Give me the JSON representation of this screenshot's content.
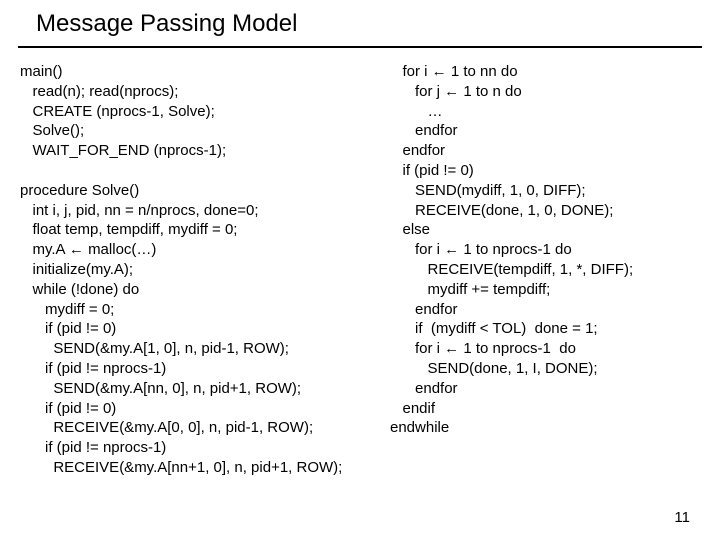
{
  "title": "Message Passing Model",
  "page_number": "11",
  "code": {
    "left": "main()\n   read(n); read(nprocs);\n   CREATE (nprocs-1, Solve);\n   Solve();\n   WAIT_FOR_END (nprocs-1);\n\nprocedure Solve()\n   int i, j, pid, nn = n/nprocs, done=0;\n   float temp, tempdiff, mydiff = 0;\n   my.A ← malloc(…)\n   initialize(my.A);\n   while (!done) do\n      mydiff = 0;\n      if (pid != 0)\n        SEND(&my.A[1, 0], n, pid-1, ROW);\n      if (pid != nprocs-1)\n        SEND(&my.A[nn, 0], n, pid+1, ROW);\n      if (pid != 0)\n        RECEIVE(&my.A[0, 0], n, pid-1, ROW);\n      if (pid != nprocs-1)\n        RECEIVE(&my.A[nn+1, 0], n, pid+1, ROW);",
    "right": "   for i ← 1 to nn do\n      for j ← 1 to n do\n         …\n      endfor\n   endfor\n   if (pid != 0)\n      SEND(mydiff, 1, 0, DIFF);\n      RECEIVE(done, 1, 0, DONE);\n   else\n      for i ← 1 to nprocs-1 do\n         RECEIVE(tempdiff, 1, *, DIFF);\n         mydiff += tempdiff;\n      endfor\n      if  (mydiff < TOL)  done = 1;\n      for i ← 1 to nprocs-1  do\n         SEND(done, 1, I, DONE);\n      endfor\n   endif\nendwhile"
  }
}
